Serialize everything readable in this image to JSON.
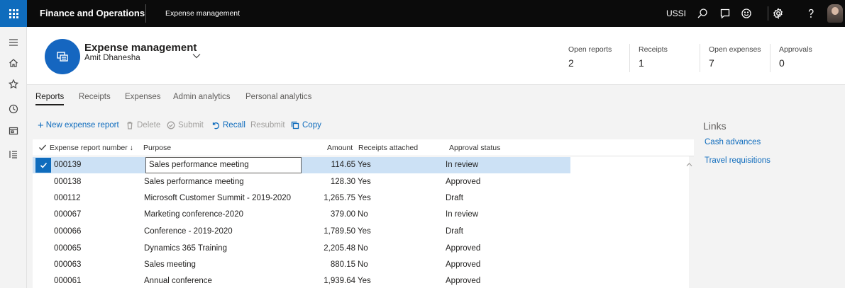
{
  "topbar": {
    "app_title": "Finance and Operations",
    "module": "Expense management",
    "company": "USSI",
    "icons": [
      "search-icon",
      "message-icon",
      "feedback-smiley-icon",
      "settings-gear-icon",
      "help-icon"
    ]
  },
  "leftnav": {
    "icons": [
      "menu-icon",
      "home-icon",
      "star-icon",
      "recent-clock-icon",
      "workspaces-icon",
      "list-icon"
    ]
  },
  "header": {
    "title": "Expense management",
    "user": "Amit Dhanesha",
    "tiles": [
      {
        "label": "Open reports",
        "value": "2"
      },
      {
        "label": "Receipts",
        "value": "1"
      },
      {
        "label": "Open expenses",
        "value": "7"
      },
      {
        "label": "Approvals",
        "value": "0"
      }
    ]
  },
  "tabs": [
    "Reports",
    "Receipts",
    "Expenses",
    "Admin analytics",
    "Personal analytics"
  ],
  "active_tab": "Reports",
  "actions": {
    "new": "New expense report",
    "delete": "Delete",
    "submit": "Submit",
    "recall": "Recall",
    "resubmit": "Resubmit",
    "copy": "Copy"
  },
  "grid": {
    "columns": {
      "number": "Expense report number ↓",
      "purpose": "Purpose",
      "amount": "Amount",
      "receipts": "Receipts attached",
      "status": "Approval status"
    },
    "rows": [
      {
        "number": "000139",
        "purpose": "Sales performance meeting",
        "amount": "114.65",
        "receipts": "Yes",
        "status": "In review",
        "selected": true
      },
      {
        "number": "000138",
        "purpose": "Sales performance meeting",
        "amount": "128.30",
        "receipts": "Yes",
        "status": "Approved"
      },
      {
        "number": "000112",
        "purpose": "Microsoft Customer Summit - 2019-2020",
        "amount": "1,265.75",
        "receipts": "Yes",
        "status": "Draft"
      },
      {
        "number": "000067",
        "purpose": "Marketing conference-2020",
        "amount": "379.00",
        "receipts": "No",
        "status": "In review"
      },
      {
        "number": "000066",
        "purpose": "Conference - 2019-2020",
        "amount": "1,789.50",
        "receipts": "Yes",
        "status": "Draft"
      },
      {
        "number": "000065",
        "purpose": "Dynamics 365 Training",
        "amount": "2,205.48",
        "receipts": "No",
        "status": "Approved"
      },
      {
        "number": "000063",
        "purpose": "Sales meeting",
        "amount": "880.15",
        "receipts": "No",
        "status": "Approved"
      },
      {
        "number": "000061",
        "purpose": "Annual conference",
        "amount": "1,939.64",
        "receipts": "Yes",
        "status": "Approved"
      }
    ]
  },
  "links": {
    "title": "Links",
    "items": [
      "Cash advances",
      "Travel requisitions"
    ]
  },
  "colors": {
    "accent": "#0f6cbd",
    "topbar": "#0b0b0b",
    "selected_row": "#cce1f5"
  }
}
